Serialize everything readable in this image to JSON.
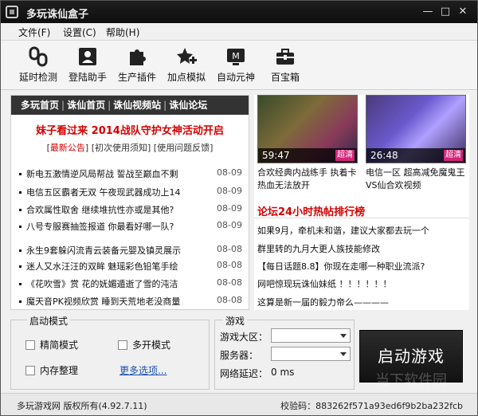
{
  "window": {
    "title": "多玩诛仙盒子",
    "min": "—",
    "max": "□",
    "close": "✕"
  },
  "menu": [
    "文件(F)",
    "设置(C)",
    "帮助(H)"
  ],
  "toolbar": [
    {
      "label": "延时检测",
      "icon": "chain-link-icon"
    },
    {
      "label": "登陆助手",
      "icon": "user-card-icon"
    },
    {
      "label": "生产插件",
      "icon": "puzzle-icon"
    },
    {
      "label": "加点模拟",
      "icon": "star-plus-icon"
    },
    {
      "label": "自动元神",
      "icon": "monitor-m-icon"
    },
    {
      "label": "百宝箱",
      "icon": "toolbox-icon"
    }
  ],
  "news": {
    "nav": [
      "多玩首页",
      "诛仙首页",
      "诛仙视频站",
      "诛仙论坛"
    ],
    "headline": "妹子看过来 2014战队守护女神活动开启",
    "subnav": {
      "latest": "最新公告",
      "first": "初次使用须知",
      "faq": "使用问题反馈"
    },
    "items": [
      {
        "title": "新电五激情逆风局帮战 誓战至巅血不剩",
        "date": "08-09"
      },
      {
        "title": "电信五区霸者无双 午夜现武器成功上14",
        "date": "08-09"
      },
      {
        "title": "合欢属性取舍 继续堆抗性亦或是其他?",
        "date": "08-09"
      },
      {
        "title": "八号专服赛抽签报道 你最看好哪一队?",
        "date": "08-09"
      },
      {
        "title": "永生9套躲闪流青云装备元婴及镇灵展示",
        "date": "08-08"
      },
      {
        "title": "迷人又水汪汪的双眸 魅瑶彩色铅笔手绘",
        "date": "08-08"
      },
      {
        "title": "《花吹雪》赏 花的妩媚遁逝了雪的沌洁",
        "date": "08-08"
      },
      {
        "title": "魔天音PK视频欣赏 睡到天荒地老没商量",
        "date": "08-08"
      }
    ]
  },
  "videos": [
    {
      "time": "59:47",
      "badge": "超清",
      "caption": "合欢经典内战练手 执着卡热血无法放开"
    },
    {
      "time": "26:48",
      "badge": "超清",
      "caption": "电信一区 超高减免魔鬼王VS仙合欢视频"
    }
  ],
  "forum": {
    "title": "论坛24小时热帖排行榜",
    "items": [
      "如果9月，牵机未和谐，建议大家都去玩一个",
      "群里转的九月大更人族技能修改",
      "【每日话题8.8】你现在走哪一种职业流派?",
      "网吧惊现玩诛仙妹纸 ！！！！！！",
      "这算是新一届的毅力帝么————"
    ]
  },
  "start_mode": {
    "title": "启动模式",
    "options": [
      "精简模式",
      "多开模式",
      "内存整理"
    ],
    "more": "更多选项..."
  },
  "game": {
    "title": "游戏",
    "region_label": "游戏大区：",
    "server_label": "服务器：",
    "latency_label": "网络延迟：",
    "latency_value": "0 ms"
  },
  "launch_label": "启动游戏",
  "watermark": "当下软件园",
  "status": {
    "copyright": "多玩游戏网 版权所有(4.92.7.11)",
    "checksum": "校验码：883262f571a93ed6f9b2ba232fcb"
  }
}
